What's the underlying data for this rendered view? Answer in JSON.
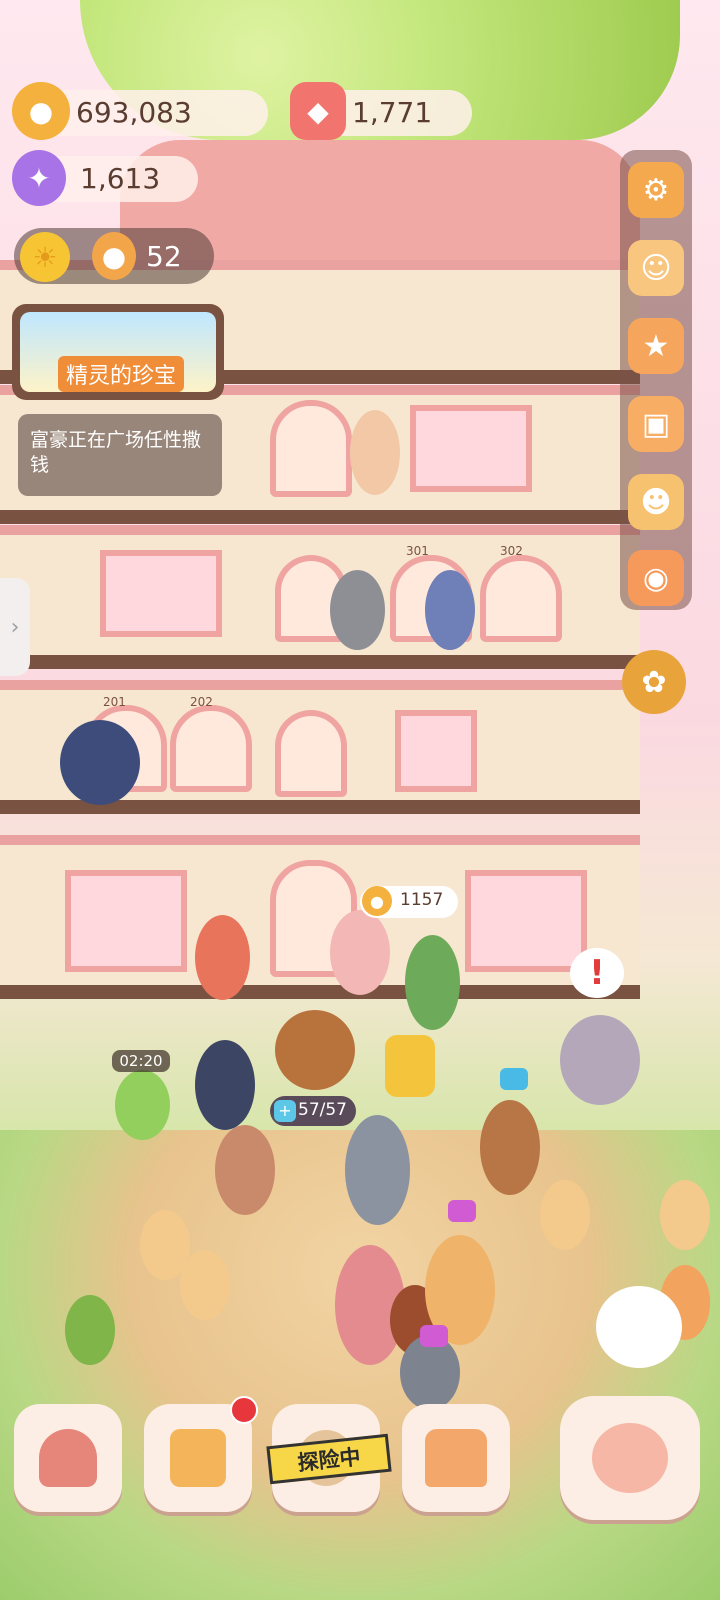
{
  "resources": {
    "coins": "693,083",
    "gems": "1,771",
    "crystals": "1,613",
    "tokens": "52"
  },
  "event_banner": {
    "title": "精灵的珍宝"
  },
  "notice": {
    "text": "富豪正在广场任性撒钱"
  },
  "room_numbers": [
    "301",
    "302",
    "201",
    "202"
  ],
  "bubbles": {
    "coin_amount": "1157",
    "timer": "02:20",
    "capacity": "57/57"
  },
  "bottom_nav": {
    "explore_label": "探险中"
  },
  "colors": {
    "accent": "#efa4a2",
    "wood": "#7a5241",
    "coin": "#f5b13d"
  }
}
